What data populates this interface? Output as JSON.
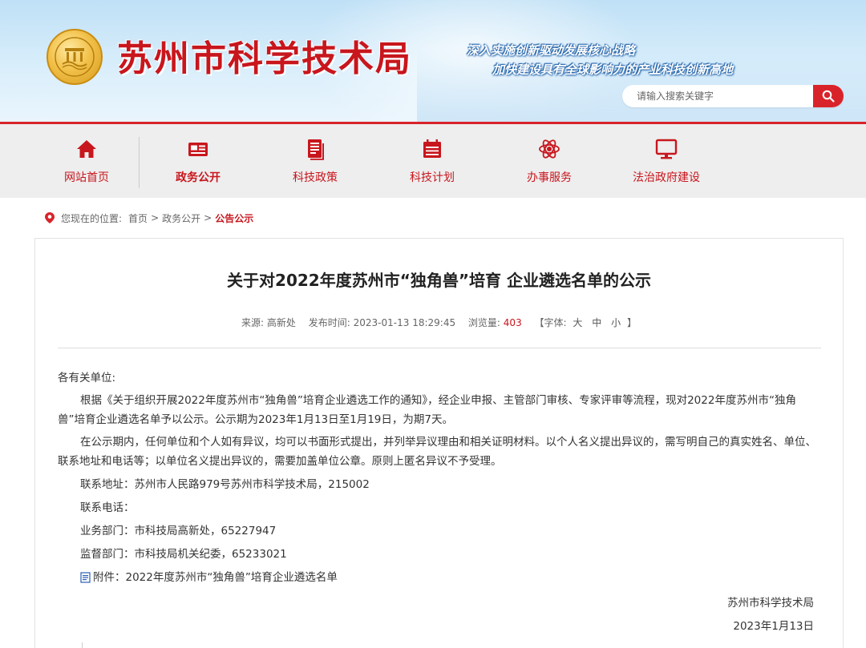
{
  "header": {
    "site_title": "苏州市科学技术局",
    "slogan_line1": "深入实施创新驱动发展核心战略",
    "slogan_line2": "加快建设具有全球影响力的产业科技创新高地",
    "search": {
      "placeholder": "请输入搜索关键字"
    },
    "emblem_icon": "government-seal-icon"
  },
  "nav": {
    "items": [
      {
        "label": "网站首页",
        "icon": "home-icon"
      },
      {
        "label": "政务公开",
        "icon": "news-icon",
        "active": true
      },
      {
        "label": "科技政策",
        "icon": "document-icon"
      },
      {
        "label": "科技计划",
        "icon": "calendar-icon"
      },
      {
        "label": "办事服务",
        "icon": "atom-icon"
      },
      {
        "label": "法治政府建设",
        "icon": "monitor-icon"
      }
    ],
    "accent_color": "#c8161d"
  },
  "breadcrumb": {
    "prefix": "您现在的位置:",
    "items": [
      "首页",
      "政务公开",
      "公告公示"
    ],
    "separator": ">"
  },
  "article": {
    "title": "关于对2022年度苏州市“独角兽”培育 企业遴选名单的公示",
    "meta": {
      "source_label": "来源:",
      "source": "高新处",
      "time_label": "发布时间:",
      "time": "2023-01-13 18:29:45",
      "views_label": "浏览量:",
      "views": "403",
      "font_open": "【字体:",
      "font_large": "大",
      "font_medium": "中",
      "font_small": "小",
      "font_close": "】"
    },
    "salutation": "各有关单位:",
    "para1": "根据《关于组织开展2022年度苏州市“独角兽”培育企业遴选工作的通知》，经企业申报、主管部门审核、专家评审等流程，现对2022年度苏州市“独角兽”培育企业遴选名单予以公示。公示期为2023年1月13日至1月19日，为期7天。",
    "para2": "在公示期内，任何单位和个人如有异议，均可以书面形式提出，并列举异议理由和相关证明材料。以个人名义提出异议的，需写明自己的真实姓名、单位、联系地址和电话等；以单位名义提出异议的，需要加盖单位公章。原则上匿名异议不予受理。",
    "address": "联系地址：苏州市人民路979号苏州市科学技术局，215002",
    "phone_label": "联系电话：",
    "dept_business": "业务部门：市科技局高新处，65227947",
    "dept_supervise": "监督部门：市科技局机关纪委，65233021",
    "attachment": "附件：2022年度苏州市“独角兽”培育企业遴选名单",
    "sign_org": "苏州市科学技术局",
    "sign_date": "2023年1月13日"
  }
}
